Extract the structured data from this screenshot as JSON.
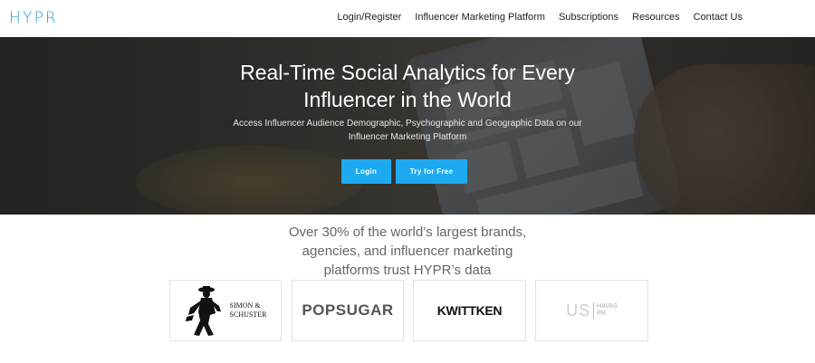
{
  "brand": {
    "logo_text": "HYPR"
  },
  "nav": {
    "items": [
      {
        "label": "Login/Register"
      },
      {
        "label": "Influencer Marketing Platform"
      },
      {
        "label": "Subscriptions"
      },
      {
        "label": "Resources"
      },
      {
        "label": "Contact Us"
      }
    ]
  },
  "hero": {
    "title_line1": "Real-Time Social Analytics for Every",
    "title_line2": "Influencer in the World",
    "subtitle_line1": "Access Influencer Audience Demographic, Psychographic and Geographic Data on our",
    "subtitle_line2": "Influencer Marketing Platform",
    "login_label": "Login",
    "try_label": "Try for Free"
  },
  "trust": {
    "line1": "Over 30% of the world’s largest brands,",
    "line2": "agencies, and influencer marketing",
    "line3": "platforms trust HYPR’s data"
  },
  "logos": {
    "simon_line1": "SIMON &",
    "simon_line2": "SCHUSTER",
    "popsugar": "POPSUGAR",
    "kwittken": "KWITTKEN",
    "us": "US",
    "havas_line1": "HAVAS",
    "havas_line2": "PR"
  },
  "colors": {
    "accent": "#1eaaf1",
    "logo": "#1e9fd8"
  }
}
